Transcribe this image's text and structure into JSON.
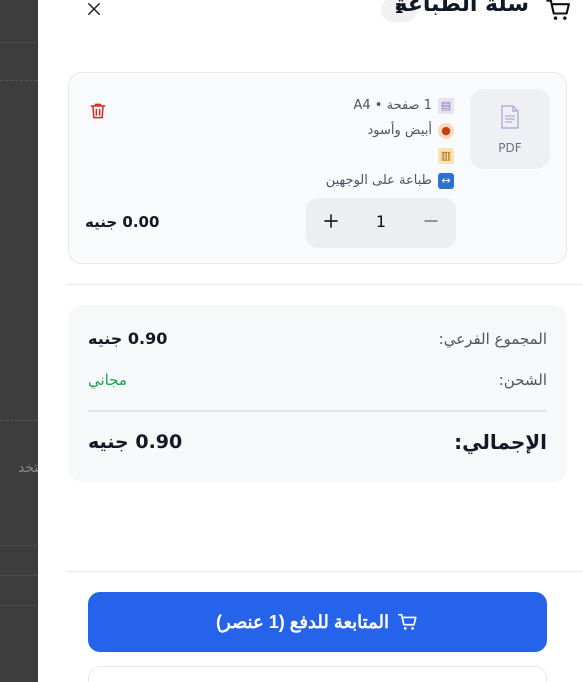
{
  "backdrop": {
    "partial_text": "ستخد"
  },
  "cart": {
    "title": "سلة الطباعة",
    "count": "1",
    "close_icon": "close-icon",
    "cart_icon": "cart-icon"
  },
  "item": {
    "file_type": "PDF",
    "file_icon": "document-icon",
    "pages": "1 صفحة • A4",
    "color_mode": "أبيض وأسود",
    "note": "",
    "sides": "طباعة على الوجهين",
    "quantity": "1",
    "price": "0.00 جنيه",
    "delete_icon": "trash-icon"
  },
  "summary": {
    "subtotal_label": "المجموع الفرعي:",
    "subtotal_value": "0.90 جنيه",
    "shipping_label": "الشحن:",
    "shipping_value": "مجاني",
    "total_label": "الإجمالي:",
    "total_value": "0.90 جنيه"
  },
  "checkout": {
    "label": "المتابعة للدفع (1 عنصر)",
    "icon": "cart-icon"
  },
  "colors": {
    "primary": "#2563eb",
    "success": "#16a34a",
    "danger": "#dc2626"
  }
}
